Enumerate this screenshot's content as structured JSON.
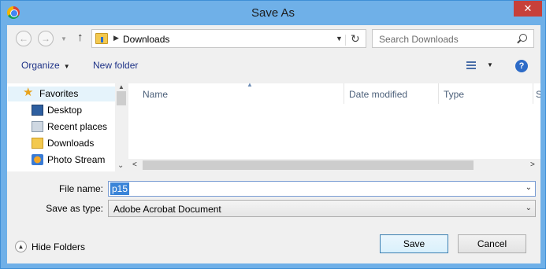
{
  "window": {
    "title": "Save As",
    "close_glyph": "✕"
  },
  "address_bar": {
    "back_glyph": "←",
    "forward_glyph": "→",
    "up_glyph": "↑",
    "separator_glyph": "▶",
    "breadcrumb": "Downloads",
    "dropdown_glyph": "▼",
    "refresh_glyph": "↻"
  },
  "search": {
    "placeholder": "Search Downloads"
  },
  "toolbar": {
    "organize_label": "Organize",
    "new_folder_label": "New folder",
    "caret_glyph": "▼",
    "help_glyph": "?"
  },
  "nav_pane": {
    "favorites_label": "Favorites",
    "items": [
      {
        "label": "Desktop",
        "icon": "desktop-icon"
      },
      {
        "label": "Recent places",
        "icon": "recent-places-icon"
      },
      {
        "label": "Downloads",
        "icon": "downloads-icon"
      },
      {
        "label": "Photo Stream",
        "icon": "photo-stream-icon"
      }
    ]
  },
  "file_list": {
    "columns": [
      "Name",
      "Date modified",
      "Type",
      "S"
    ],
    "sort_glyph": "▲"
  },
  "form": {
    "file_name_label": "File name:",
    "file_name_value": "p15",
    "save_type_label": "Save as type:",
    "save_type_value": "Adobe Acrobat Document",
    "dropdown_glyph": "⌄"
  },
  "footer": {
    "hide_folders_label": "Hide Folders",
    "hide_glyph": "▲",
    "save_label": "Save",
    "cancel_label": "Cancel"
  },
  "colors": {
    "title_bar": "#6fb0e8",
    "close_button": "#c7403a",
    "selection": "#3a84d8",
    "link_text": "#1e3287"
  }
}
